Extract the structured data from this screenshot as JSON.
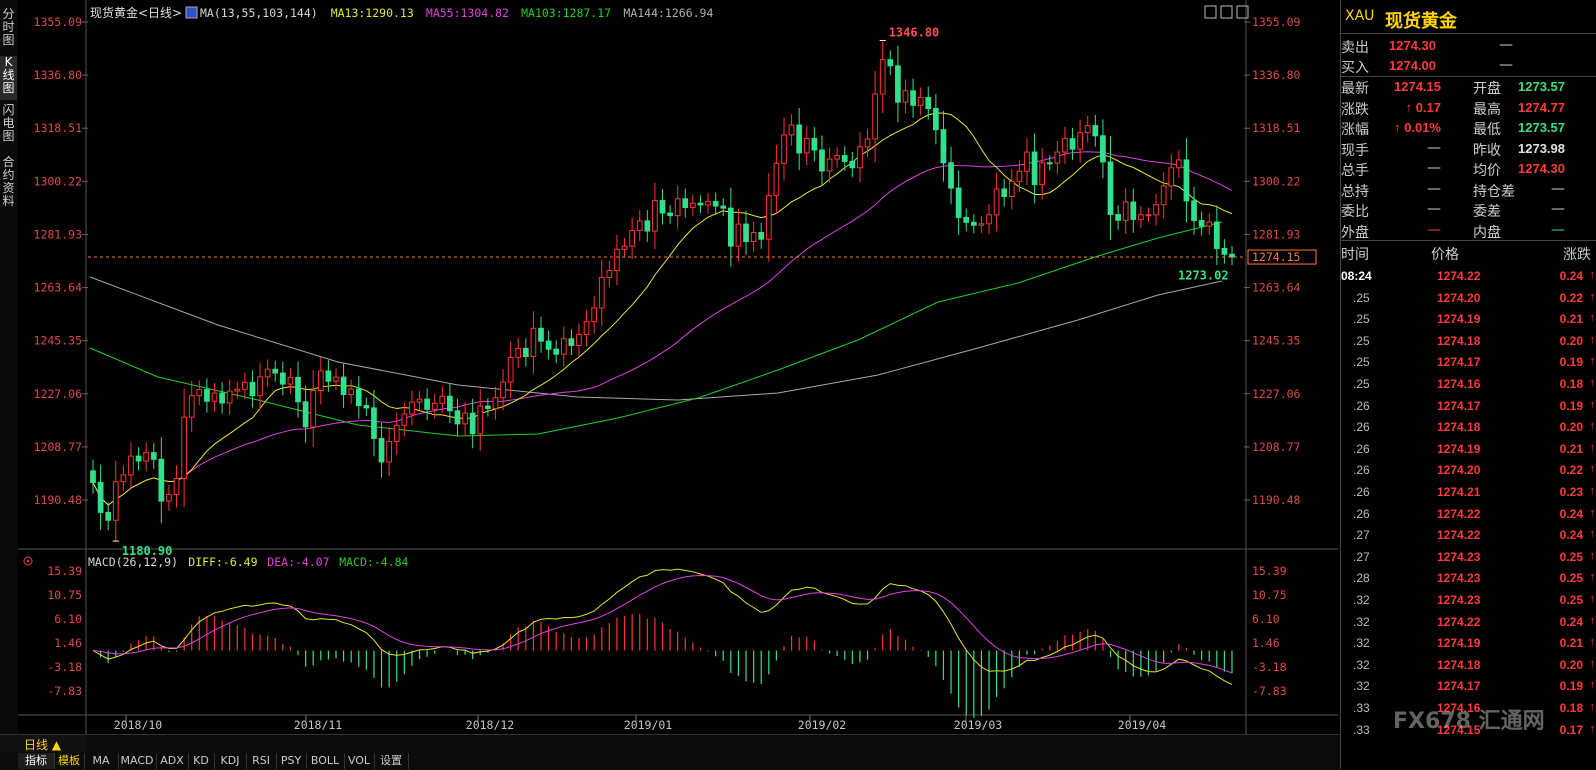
{
  "chart_data": {
    "type": "candlestick",
    "title": "现货黄金<日线>",
    "ma_legend": [
      {
        "text": "MA(13,55,103,144)",
        "color": "#d8d8d8"
      },
      {
        "text": "MA13:1290.13",
        "color": "#e6e62a"
      },
      {
        "text": "MA55:1304.82",
        "color": "#e040e0"
      },
      {
        "text": "MA103:1287.17",
        "color": "#20d020"
      },
      {
        "text": "MA144:1266.94",
        "color": "#b0b0b0"
      }
    ],
    "y_ticks": [
      "1355.09",
      "1336.80",
      "1318.51",
      "1300.22",
      "1281.93",
      "1263.64",
      "1245.35",
      "1227.06",
      "1208.77",
      "1190.48"
    ],
    "ylim": [
      1172.2,
      1355.09
    ],
    "x_labels": [
      "2018/10",
      "2018/11",
      "2018/12",
      "2019/01",
      "2019/02",
      "2019/03",
      "2019/04"
    ],
    "high_label": "1346.80",
    "low_label": "1180.90",
    "last_low_label": "1273.02",
    "current_price_label": "1274.15",
    "current_price": 1274.15,
    "close": [
      1196.5,
      1186.2,
      1183.5,
      1196.8,
      1199.1,
      1205.6,
      1203.9,
      1206.8,
      1204.5,
      1190.1,
      1192.4,
      1197.9,
      1219.0,
      1226.4,
      1228.5,
      1224.5,
      1227.3,
      1223.9,
      1228.0,
      1228.6,
      1231.0,
      1226.4,
      1232.9,
      1235.5,
      1234.2,
      1230.4,
      1232.7,
      1224.3,
      1215.7,
      1228.2,
      1234.9,
      1231.4,
      1232.8,
      1226.8,
      1228.7,
      1223.0,
      1222.2,
      1211.7,
      1203.6,
      1210.6,
      1216.2,
      1220.1,
      1224.2,
      1225.2,
      1221.7,
      1223.8,
      1226.2,
      1221.2,
      1216.7,
      1220.4,
      1213.3,
      1222.8,
      1222.0,
      1225.7,
      1231.1,
      1239.6,
      1242.7,
      1239.9,
      1249.6,
      1245.2,
      1242.4,
      1240.7,
      1246.0,
      1243.7,
      1247.5,
      1251.9,
      1256.6,
      1267.1,
      1269.5,
      1276.8,
      1277.9,
      1283.3,
      1286.6,
      1283.1,
      1293.6,
      1289.3,
      1288.4,
      1294.2,
      1291.2,
      1292.7,
      1292.1,
      1293.3,
      1291.7,
      1291.0,
      1277.9,
      1285.5,
      1279.5,
      1282.6,
      1280.3,
      1295.3,
      1306.4,
      1316.2,
      1319.6,
      1310.0,
      1315.0,
      1311.0,
      1303.8,
      1307.9,
      1309.1,
      1307.1,
      1304.9,
      1312.1,
      1314.8,
      1330.3,
      1342.1,
      1340.0,
      1327.5,
      1331.4,
      1326.4,
      1329.1,
      1325.3,
      1318.0,
      1306.6,
      1297.9,
      1287.8,
      1286.1,
      1285.1,
      1285.6,
      1288.7,
      1297.6,
      1295.0,
      1300.2,
      1303.7,
      1310.3,
      1299.1,
      1306.6,
      1306.5,
      1310.3,
      1314.9,
      1311.3,
      1317.0,
      1319.4,
      1315.9,
      1306.9,
      1288.8,
      1286.8,
      1293.1,
      1287.1,
      1288.7,
      1288.7,
      1292.2,
      1298.6,
      1304.9,
      1307.6,
      1293.5,
      1286.7,
      1284.8,
      1286.2,
      1277.1,
      1275.1,
      1274.15
    ]
  },
  "macd": {
    "legend": [
      {
        "text": "MACD(26,12,9)",
        "color": "#d8d8d8"
      },
      {
        "text": "DIFF:-6.49",
        "color": "#e6e62a"
      },
      {
        "text": "DEA:-4.07",
        "color": "#e040e0"
      },
      {
        "text": "MACD:-4.84",
        "color": "#20d020"
      }
    ],
    "y_ticks": [
      "15.39",
      "10.75",
      "6.10",
      "1.46",
      "-3.18",
      "-7.83"
    ]
  },
  "left_tabs": [
    "分时图",
    "K线图",
    "闪电图",
    "合约资料"
  ],
  "bottom": {
    "mode_label": "日线 ▲",
    "tabs": [
      "指标",
      "模板",
      "MA",
      "MACD",
      "ADX",
      "KD",
      "KDJ",
      "RSI",
      "PSY",
      "BOLL",
      "VOL",
      "设置"
    ]
  },
  "panel": {
    "symbol": "XAU",
    "name": "现货黄金",
    "sell_label": "卖出",
    "sell": "1274.30",
    "sell_vol": "—",
    "buy_label": "买入",
    "buy": "1274.00",
    "buy_vol": "—",
    "stats": [
      {
        "l1": "最新",
        "v1": "1274.15",
        "c1": "#ff3a3a",
        "l2": "开盘",
        "v2": "1273.57",
        "c2": "#3ae07a"
      },
      {
        "l1": "涨跌",
        "v1": "↑ 0.17",
        "c1": "#ff3a3a",
        "l2": "最高",
        "v2": "1274.77",
        "c2": "#ff3a3a"
      },
      {
        "l1": "涨幅",
        "v1": "↑ 0.01%",
        "c1": "#ff3a3a",
        "l2": "最低",
        "v2": "1273.57",
        "c2": "#3ae07a"
      },
      {
        "l1": "现手",
        "v1": "—",
        "c1": "#ccc",
        "l2": "昨收",
        "v2": "1273.98",
        "c2": "#e0e0e0"
      },
      {
        "l1": "总手",
        "v1": "—",
        "c1": "#ccc",
        "l2": "均价",
        "v2": "1274.30",
        "c2": "#ff3a3a"
      },
      {
        "l1": "总持",
        "v1": "—",
        "c1": "#ccc",
        "l2": "持仓差",
        "v2": "—",
        "c2": "#ccc"
      },
      {
        "l1": "委比",
        "v1": "—",
        "c1": "#ccc",
        "l2": "委差",
        "v2": "—",
        "c2": "#ccc"
      },
      {
        "l1": "外盘",
        "v1": "—",
        "c1": "#ff3a3a",
        "l2": "内盘",
        "v2": "—",
        "c2": "#3ae07a"
      }
    ],
    "ticks_header": {
      "time": "时间",
      "price": "价格",
      "change": "涨跌"
    },
    "ticks": [
      {
        "t": "08:24",
        "p": "1274.22",
        "c": "0.24"
      },
      {
        "t": ".25",
        "p": "1274.20",
        "c": "0.22"
      },
      {
        "t": ".25",
        "p": "1274.19",
        "c": "0.21"
      },
      {
        "t": ".25",
        "p": "1274.18",
        "c": "0.20"
      },
      {
        "t": ".25",
        "p": "1274.17",
        "c": "0.19"
      },
      {
        "t": ".25",
        "p": "1274.16",
        "c": "0.18"
      },
      {
        "t": ".26",
        "p": "1274.17",
        "c": "0.19"
      },
      {
        "t": ".26",
        "p": "1274.18",
        "c": "0.20"
      },
      {
        "t": ".26",
        "p": "1274.19",
        "c": "0.21"
      },
      {
        "t": ".26",
        "p": "1274.20",
        "c": "0.22"
      },
      {
        "t": ".26",
        "p": "1274.21",
        "c": "0.23"
      },
      {
        "t": ".26",
        "p": "1274.22",
        "c": "0.24"
      },
      {
        "t": ".27",
        "p": "1274.22",
        "c": "0.24"
      },
      {
        "t": ".27",
        "p": "1274.23",
        "c": "0.25"
      },
      {
        "t": ".28",
        "p": "1274.23",
        "c": "0.25"
      },
      {
        "t": ".32",
        "p": "1274.23",
        "c": "0.25"
      },
      {
        "t": ".32",
        "p": "1274.22",
        "c": "0.24"
      },
      {
        "t": ".32",
        "p": "1274.19",
        "c": "0.21"
      },
      {
        "t": ".32",
        "p": "1274.18",
        "c": "0.20"
      },
      {
        "t": ".32",
        "p": "1274.17",
        "c": "0.19"
      },
      {
        "t": ".33",
        "p": "1274.16",
        "c": "0.18"
      },
      {
        "t": ".33",
        "p": "1274.15",
        "c": "0.17"
      }
    ],
    "watermark": "FX678 汇通网"
  },
  "colors": {
    "up": "#ff3232",
    "down": "#32e08c",
    "ma13": "#e6e62a",
    "ma55": "#e040e0",
    "ma103": "#20d020",
    "ma144": "#a8a8a8",
    "axis_red": "#e04848",
    "grid": "#555"
  }
}
